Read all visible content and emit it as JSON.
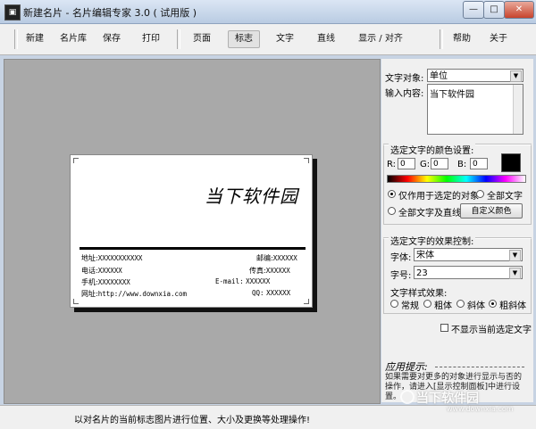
{
  "window": {
    "title": "新建名片 - 名片编辑专家 3.0 ( 试用版 )",
    "controls": [
      "minimize",
      "maximize",
      "close"
    ]
  },
  "toolbar": {
    "items": [
      "新建",
      "名片库",
      "保存",
      "打印",
      "页面",
      "标志",
      "文字",
      "直线",
      "显示 / 对齐",
      "帮助",
      "关于"
    ],
    "active": "标志"
  },
  "card": {
    "title": "当下软件园",
    "address_label": "地址:",
    "address_value": "XXXXXXXXXXX",
    "zip_label": "邮编:",
    "zip_value": "XXXXXX",
    "phone_label": "电话:",
    "phone_value": "XXXXXX",
    "fax_label": "传真:",
    "fax_value": "XXXXXX",
    "mobile_label": "手机:",
    "mobile_value": "XXXXXXXX",
    "email_label": "E-mail:",
    "email_value": "XXXXXX",
    "web_label": "网址:",
    "web_value": "http://www.downxia.com",
    "qq_label": "QQ:",
    "qq_value": "XXXXXX"
  },
  "panel": {
    "text_object_label": "文字对象:",
    "text_object_value": "单位",
    "input_label": "输入内容:",
    "input_value": "当下软件园",
    "color_group_title": "选定文字的颜色设置:",
    "r_label": "R:",
    "r_value": "0",
    "g_label": "G:",
    "g_value": "0",
    "b_label": "B:",
    "b_value": "0",
    "swatch_color": "#000000",
    "radio_selected_only": "仅作用于选定的对象",
    "radio_all_text": "全部文字",
    "radio_all_text_lines": "全部文字及直线",
    "custom_color_button": "自定义颜色",
    "effect_group_title": "选定文字的效果控制:",
    "font_label": "字体:",
    "font_value": "宋体",
    "size_label": "字号:",
    "size_value": "23",
    "style_label": "文字样式效果:",
    "style_normal": "常规",
    "style_bold": "粗体",
    "style_italic": "斜体",
    "style_bold_italic": "粗斜体",
    "style_selected": "粗斜体",
    "hide_check_label": "不显示当前选定文字",
    "hint_title": "应用提示:",
    "hint_text": "如果需要对更多的对象进行显示与否的操作，请进入[显示控制面板]中进行设置。"
  },
  "status": {
    "text": "以对名片的当前标志图片进行位置、大小及更换等处理操作!"
  },
  "watermark": {
    "name": "当下软件园",
    "url": "www.downxia.com"
  }
}
